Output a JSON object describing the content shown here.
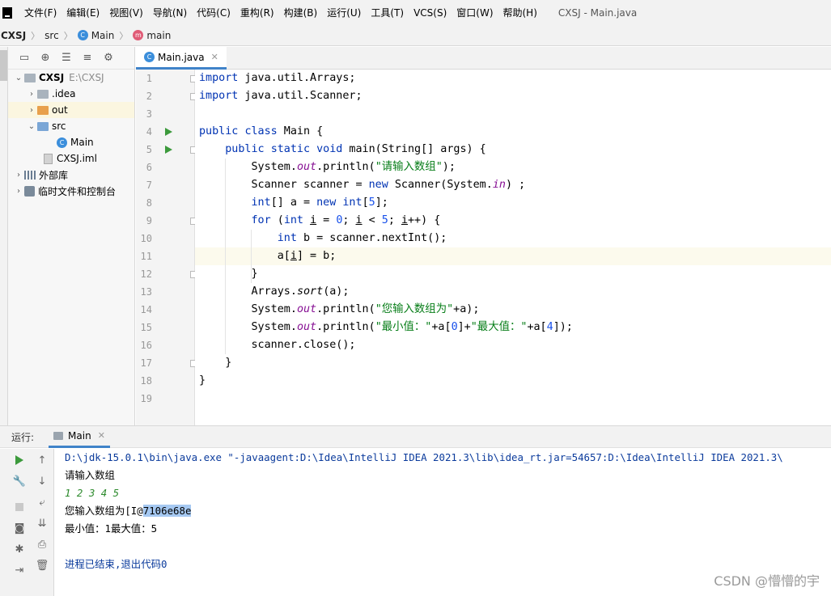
{
  "menu": {
    "items": [
      "文件(F)",
      "编辑(E)",
      "视图(V)",
      "导航(N)",
      "代码(C)",
      "重构(R)",
      "构建(B)",
      "运行(U)",
      "工具(T)",
      "VCS(S)",
      "窗口(W)",
      "帮助(H)"
    ],
    "window_title": "CXSJ - Main.java"
  },
  "breadcrumb": {
    "project": "CXSJ",
    "folder": "src",
    "class": "Main",
    "method": "main"
  },
  "project_tree": {
    "root_label": "CXSJ",
    "root_path": "E:\\CXSJ",
    "idea": ".idea",
    "out": "out",
    "src": "src",
    "main": "Main",
    "iml": "CXSJ.iml",
    "external_libs": "外部库",
    "scratches": "临时文件和控制台"
  },
  "editor": {
    "tab_label": "Main.java",
    "line_numbers": [
      "1",
      "2",
      "3",
      "4",
      "5",
      "6",
      "7",
      "8",
      "9",
      "10",
      "11",
      "12",
      "13",
      "14",
      "15",
      "16",
      "17",
      "18",
      "19"
    ],
    "tokens": {
      "kw_import": "import",
      "imp1": " java.util.Arrays;",
      "imp2": " java.util.Scanner;",
      "kw_public": "public",
      "kw_class": "class",
      "main_class": " Main {",
      "kw_static": "static",
      "kw_void": "void",
      "main_sig": " main(String[] args) {",
      "sys": "System.",
      "out": "out",
      "println_open": ".println(",
      "str_prompt": "\"请输入数组\"",
      "close_paren_semi": ");",
      "scanner_decl": "Scanner scanner = ",
      "kw_new": "new",
      "scanner_ctor": " Scanner(System.",
      "in": "in",
      "scanner_end": ") ;",
      "kw_int": "int",
      "arr_decl": "[] a = ",
      "arr_open": "[",
      "num5": "5",
      "arr_close": "];",
      "kw_for": "for",
      "for_open": " (",
      "i": "i",
      "eq": " = ",
      "num0": "0",
      "semi": "; ",
      "lt": " < ",
      "pp": "++) {",
      "b_decl": " b = scanner.nextInt();",
      "a_open": "a[",
      "a_assign": "] = b;",
      "rbrace": "}",
      "arrays_sort": "Arrays.",
      "sort": "sort",
      "sort_arg": "(a);",
      "str_result": "\"您输入数组为\"",
      "plus_a": "+a);",
      "str_min": "\"最小值：\"",
      "plus_a0": "+a[",
      "num0b": "0",
      "plus_str": "]+",
      "str_max": "\"最大值：\"",
      "plus_a4": "+a[",
      "num4": "4",
      "end_a4": "]);",
      "close_stmt": "scanner.close();"
    }
  },
  "run_panel": {
    "label": "运行:",
    "tab_label": "Main",
    "console": {
      "cmd": "D:\\jdk-15.0.1\\bin\\java.exe \"-javaagent:D:\\Idea\\IntelliJ IDEA 2021.3\\lib\\idea_rt.jar=54657:D:\\Idea\\IntelliJ IDEA 2021.3\\",
      "prompt": "请输入数组",
      "input": "1 2 3 4 5",
      "result_prefix": "您输入数组为[I@",
      "result_hash": "7106e68e",
      "minmax": "最小值：1最大值：5",
      "exit": "进程已结束,退出代码0"
    }
  },
  "watermark": "CSDN @懵懵的宇",
  "colors": {
    "keyword": "#0033b3",
    "string": "#067d17",
    "number": "#1750eb",
    "field": "#871094",
    "accent": "#4083c9",
    "run_green": "#3c9a3c"
  }
}
